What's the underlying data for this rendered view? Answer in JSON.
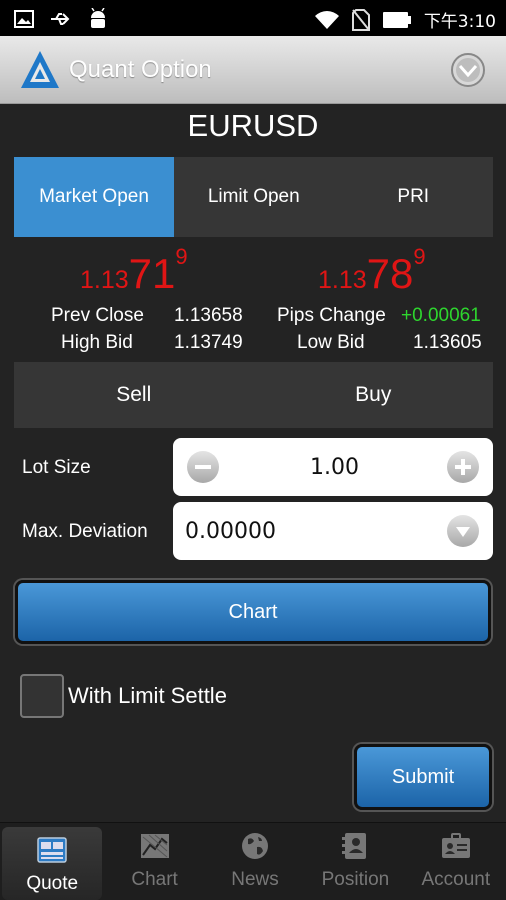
{
  "status_bar": {
    "time": "下午3:10",
    "icons": [
      "image-icon",
      "usb-icon",
      "android-icon",
      "wifi-icon",
      "no-sim-icon",
      "battery-icon"
    ]
  },
  "app_bar": {
    "title": "Quant Option",
    "logo_icon": "quant-logo",
    "menu_icon": "chevron-down-circle-icon"
  },
  "symbol": "EURUSD",
  "tabs": [
    {
      "label": "Market Open",
      "active": true
    },
    {
      "label": "Limit Open",
      "active": false
    },
    {
      "label": "PRI",
      "active": false
    }
  ],
  "quotes": {
    "sell": {
      "prefix": "1.13",
      "big": "71",
      "sup": "9"
    },
    "buy": {
      "prefix": "1.13",
      "big": "78",
      "sup": "9"
    }
  },
  "stats": {
    "prev_close_label": "Prev Close",
    "prev_close_value": "1.13658",
    "pips_change_label": "Pips Change",
    "pips_change_value": "+0.00061",
    "high_bid_label": "High Bid",
    "high_bid_value": "1.13749",
    "low_bid_label": "Low Bid",
    "low_bid_value": "1.13605"
  },
  "sell_label": "Sell",
  "buy_label": "Buy",
  "lot_size": {
    "label": "Lot Size",
    "value": "1.00"
  },
  "max_deviation": {
    "label": "Max. Deviation",
    "value": "0.00000"
  },
  "chart_button": "Chart",
  "limit_settle": {
    "label": "With Limit Settle",
    "checked": false
  },
  "submit_button": "Submit",
  "colors": {
    "accent": "#3b8fd1",
    "quote_red": "#e01515",
    "positive_green": "#2ed52e"
  },
  "nav": [
    {
      "label": "Quote",
      "icon": "quote-icon",
      "active": true
    },
    {
      "label": "Chart",
      "icon": "chart-icon",
      "active": false
    },
    {
      "label": "News",
      "icon": "globe-icon",
      "active": false
    },
    {
      "label": "Position",
      "icon": "position-icon",
      "active": false
    },
    {
      "label": "Account",
      "icon": "account-icon",
      "active": false
    }
  ]
}
